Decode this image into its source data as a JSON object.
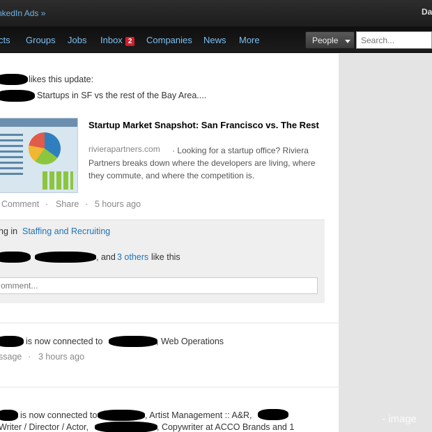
{
  "topbar": {
    "ads_link": "nkedIn Ads »",
    "user_name": "Da"
  },
  "nav": {
    "items": [
      "cts",
      "Groups",
      "Jobs",
      "Inbox",
      "Companies",
      "News",
      "More"
    ],
    "inbox_count": "2"
  },
  "search": {
    "scope": "People",
    "placeholder": "Search..."
  },
  "update1": {
    "actor_suffix": "likes this update:",
    "headline_suffix": "Startups in SF vs the rest of the Bay Area....",
    "article_title": "Startup Market Snapshot: San Francisco vs. The Rest",
    "article_source": "rivierapartners.com",
    "article_desc": "· Looking for a startup office? Riviera Partners breaks down where the developers are living, where they commute, and where the competition is.",
    "action_comment": "Comment",
    "action_share": "Share",
    "separator": "·",
    "timestamp": "5 hours ago",
    "group_prefix": "ng in",
    "group_name": "Staffing and Recruiting",
    "likes_mid": ", and",
    "likes_others": "3 others",
    "likes_suffix": "like this",
    "comment_placeholder": "omment..."
  },
  "update2": {
    "connected_text": "is now connected to",
    "connected_role": ", Web Operations",
    "action_message": "ssage",
    "separator": "·",
    "timestamp": "3 hours ago"
  },
  "update3": {
    "connected_text": "is now connected to",
    "line1_role": ", Artist Management :: A&R,",
    "line2_start": "Writer / Director / Actor,",
    "line2_end": ", Copywriter at ACCO Brands and 1"
  },
  "watermark": "- image"
}
